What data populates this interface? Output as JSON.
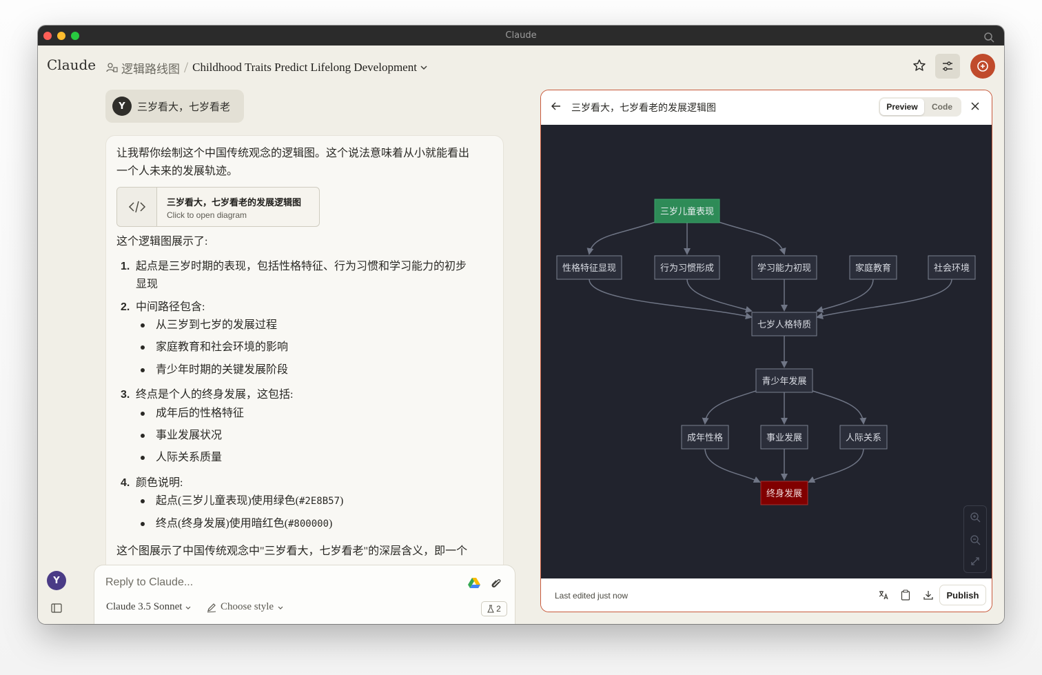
{
  "window": {
    "title": "Claude"
  },
  "header": {
    "logo": "Claude",
    "project": "逻辑路线图",
    "conversation_title": "Childhood Traits Predict Lifelong Development"
  },
  "user_message": {
    "avatar": "Y",
    "text": "三岁看大，七岁看老"
  },
  "assistant": {
    "intro": "让我帮你绘制这个中国传统观念的逻辑图。这个说法意味着从小就能看出一个人未来的发展轨迹。",
    "artifact_card": {
      "title": "三岁看大，七岁看老的发展逻辑图",
      "subtitle": "Click to open diagram"
    },
    "shows": "这个逻辑图展示了:",
    "points": [
      {
        "num": "1.",
        "text": "起点是三岁时期的表现，包括性格特征、行为习惯和学习能力的初步",
        "text2": "显现"
      },
      {
        "num": "2.",
        "text": "中间路径包含:",
        "bullets": [
          "从三岁到七岁的发展过程",
          "家庭教育和社会环境的影响",
          "青少年时期的关键发展阶段"
        ]
      },
      {
        "num": "3.",
        "text": "终点是个人的终身发展，这包括:",
        "bullets": [
          "成年后的性格特征",
          "事业发展状况",
          "人际关系质量"
        ]
      },
      {
        "num": "4.",
        "text": "颜色说明:",
        "bullets_a": [
          "起点(三岁儿童表现)使用绿色(",
          "#2E8B57",
          ")"
        ],
        "bullets_b": [
          "终点(终身发展)使用暗红色(",
          "#800000",
          ")"
        ]
      }
    ],
    "summary": "这个图展示了中国传统观念中\"三岁看大，七岁看老\"的深层含义，即一个"
  },
  "composer": {
    "placeholder": "Reply to Claude...",
    "model": "Claude 3.5 Sonnet",
    "style": "Choose style",
    "badge_count": "2"
  },
  "sidebar": {
    "avatar": "Y"
  },
  "artifact": {
    "title": "三岁看大，七岁看老的发展逻辑图",
    "tab_preview": "Preview",
    "tab_code": "Code",
    "last_edited": "Last edited just now",
    "publish": "Publish"
  },
  "diagram": {
    "colors": {
      "start": "#2E8B57",
      "end": "#800000",
      "node": "#2b2e3a",
      "edge": "#6f7585",
      "background": "#21232d"
    },
    "nodes": {
      "start": "三岁儿童表现",
      "personality": "性格特征显现",
      "behavior": "行为习惯形成",
      "learning": "学习能力初现",
      "family": "家庭教育",
      "society": "社会环境",
      "seven": "七岁人格特质",
      "youth": "青少年发展",
      "adult": "成年性格",
      "career": "事业发展",
      "relations": "人际关系",
      "end": "终身发展"
    }
  }
}
